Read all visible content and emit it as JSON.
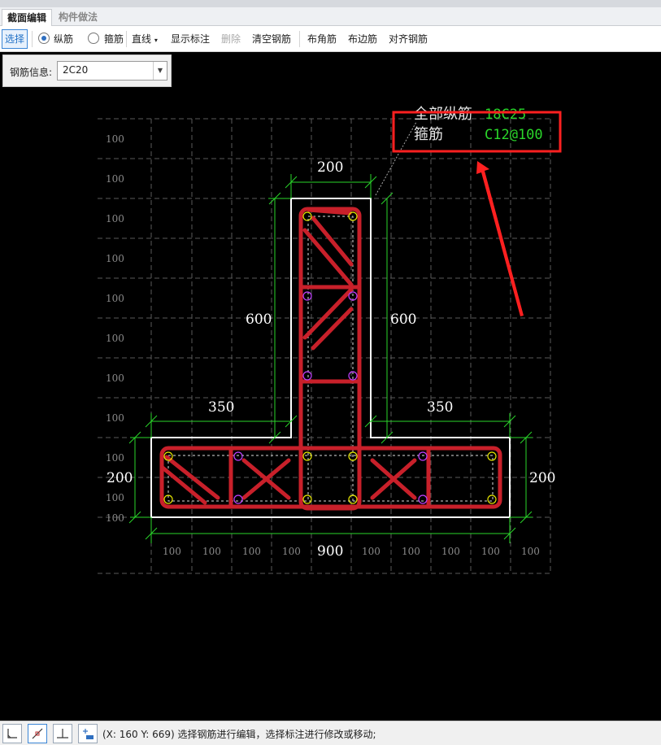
{
  "tabs": {
    "active": "截面编辑",
    "inactive": "构件做法"
  },
  "toolbar": {
    "select": "选择",
    "longitudinal": "纵筋",
    "stirrup": "箍筋",
    "line": "直线",
    "show_dims": "显示标注",
    "delete": "删除",
    "clear_rebar": "清空钢筋",
    "corner_rebar": "布角筋",
    "edge_rebar": "布边筋",
    "align_rebar": "对齐钢筋"
  },
  "rebar_info": {
    "label": "钢筋信息:",
    "value": "2C20"
  },
  "drawing": {
    "grid_label": "100",
    "summary": {
      "all_longitudinal_label": "全部纵筋",
      "all_longitudinal_value": "18C25",
      "stirrup_label": "箍筋",
      "stirrup_value": "C12@100"
    },
    "dims": {
      "web_width": "200",
      "web_height_left": "600",
      "web_height_right": "600",
      "flange_left": "350",
      "flange_right": "350",
      "flange_height_left": "200",
      "flange_height_right": "200",
      "total_width": "900"
    },
    "colors": {
      "concrete_outline": "#ffffff",
      "rebar": "#c8202a",
      "dimension": "#2ad62a",
      "callout": "#ff2020"
    }
  },
  "status": {
    "coords": "(X: 160 Y: 669)",
    "message": "选择钢筋进行编辑，选择标注进行修改或移动;"
  }
}
